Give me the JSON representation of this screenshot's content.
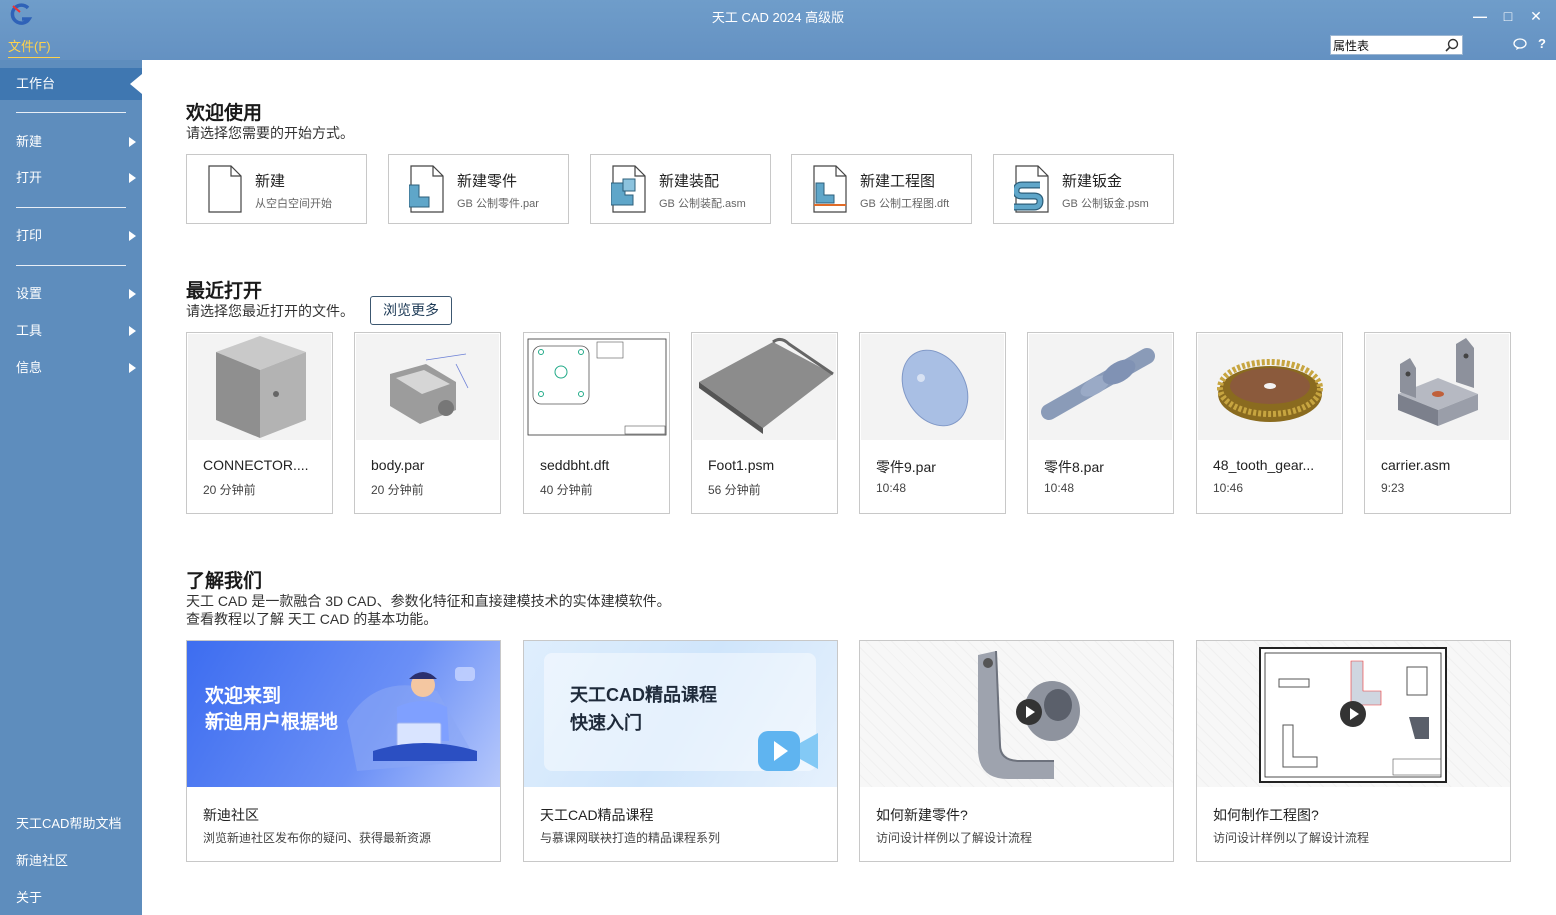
{
  "window": {
    "title": "天工 CAD 2024 高级版",
    "menu_file": "文件(F)",
    "search_value": "属性表",
    "help": "?"
  },
  "sidebar": {
    "active": "工作台",
    "items": [
      "新建",
      "打开",
      "打印",
      "设置",
      "工具",
      "信息"
    ],
    "links": [
      "天工CAD帮助文档",
      "新迪社区",
      "关于"
    ]
  },
  "welcome": {
    "title": "欢迎使用",
    "subtitle": "请选择您需要的开始方式。",
    "cards": [
      {
        "title": "新建",
        "sub": "从空白空间开始",
        "icon": "blank-doc-icon"
      },
      {
        "title": "新建零件",
        "sub": "GB 公制零件.par",
        "icon": "part-doc-icon"
      },
      {
        "title": "新建装配",
        "sub": "GB 公制装配.asm",
        "icon": "assembly-doc-icon"
      },
      {
        "title": "新建工程图",
        "sub": "GB 公制工程图.dft",
        "icon": "drawing-doc-icon"
      },
      {
        "title": "新建钣金",
        "sub": "GB 公制钣金.psm",
        "icon": "sheetmetal-doc-icon"
      }
    ]
  },
  "recent": {
    "title": "最近打开",
    "subtitle": "请选择您最近打开的文件。",
    "browse_more": "浏览更多",
    "files": [
      {
        "name": "CONNECTOR....",
        "time": "20 分钟前"
      },
      {
        "name": "body.par",
        "time": "20 分钟前"
      },
      {
        "name": "seddbht.dft",
        "time": "40 分钟前"
      },
      {
        "name": "Foot1.psm",
        "time": "56 分钟前"
      },
      {
        "name": "零件9.par",
        "time": "10:48"
      },
      {
        "name": "零件8.par",
        "time": "10:48"
      },
      {
        "name": "48_tooth_gear...",
        "time": "10:46"
      },
      {
        "name": "carrier.asm",
        "time": "9:23"
      }
    ]
  },
  "about": {
    "title": "了解我们",
    "line1": "天工 CAD 是一款融合 3D CAD、参数化特征和直接建模技术的实体建模软件。",
    "line2": "查看教程以了解 天工 CAD 的基本功能。",
    "cards": [
      {
        "title": "新迪社区",
        "sub": "浏览新迪社区发布你的疑问、获得最新资源",
        "banner1": "欢迎来到",
        "banner2": "新迪用户根据地"
      },
      {
        "title": "天工CAD精品课程",
        "sub": "与慕课网联袂打造的精品课程系列",
        "banner1": "天工CAD精品课程",
        "banner2": "快速入门"
      },
      {
        "title": "如何新建零件?",
        "sub": "访问设计样例以了解设计流程"
      },
      {
        "title": "如何制作工程图?",
        "sub": "访问设计样例以了解设计流程"
      }
    ]
  }
}
